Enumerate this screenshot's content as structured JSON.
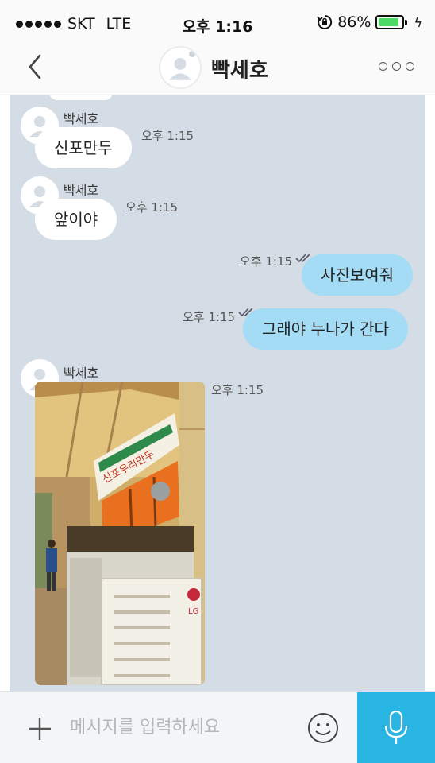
{
  "status_bar": {
    "carrier": "SKT",
    "network": "LTE",
    "time": "오후 1:16",
    "battery_percent": "86%",
    "battery_level": 0.86,
    "icons": [
      "signal-dots-icon",
      "rotation-lock-icon",
      "battery-icon",
      "charging-bolt-icon"
    ]
  },
  "header": {
    "back_icon": "chevron-left-icon",
    "title": "빡세호",
    "more_icon": "more-dots-icon"
  },
  "messages": [
    {
      "direction": "in",
      "sender": "빡세호",
      "text": "신포만두",
      "time": "오후 1:15"
    },
    {
      "direction": "in",
      "sender": "빡세호",
      "text": "앞이야",
      "time": "오후 1:15"
    },
    {
      "direction": "out",
      "text": "사진보여줘",
      "time": "오후 1:15",
      "read": true
    },
    {
      "direction": "out",
      "text": "그래야 누나가 간다",
      "time": "오후 1:15",
      "read": true
    },
    {
      "direction": "in",
      "sender": "빡세호",
      "type": "photo",
      "time": "오후 1:15",
      "photo_sign_text": "신포우리만두",
      "photo_unit_brand": "LG"
    }
  ],
  "input_bar": {
    "plus_icon": "plus-icon",
    "placeholder": "메시지를 입력하세요",
    "emoji_icon": "emoji-smile-icon",
    "mic_icon": "microphone-icon"
  },
  "colors": {
    "chat_background": "#d4dde6",
    "incoming_bubble": "#ffffff",
    "outgoing_bubble": "#a4dcf5",
    "mic_button": "#29b5e3",
    "battery_fill": "#4cd964"
  }
}
